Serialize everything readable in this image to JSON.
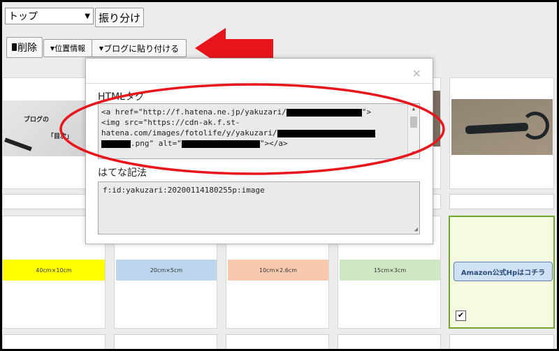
{
  "toolbar": {
    "folder_select": "トップ",
    "distribute_label": "振り分け",
    "delete_label": "削除",
    "location_label": "位置情報",
    "paste_label": "ブログに貼り付ける"
  },
  "dialog": {
    "html_label": "HTMLタグ",
    "html_code": {
      "l1a": "<a href=\"http://f.hatena.ne.jp/yakuzari/",
      "l1b": "\">",
      "l2": "<img src=\"https://cdn-ak.f.st-",
      "l3a": "hatena.com/images/fotolife/y/yakuzari/",
      "l4a": ".png\" alt=\"",
      "l4b": "\"></a>"
    },
    "hatena_label": "はてな記法",
    "hatena_code": "f:id:yakuzari:20200114180255p:image"
  },
  "grid": {
    "thumb1_text1": "ブログの",
    "thumb1_text2": "「目次」",
    "swatch1": "40cm×10cm",
    "swatch2": "20cm×5cm",
    "swatch3": "10cm×2.6cm",
    "swatch4": "15cm×3cm",
    "amazon_label": "Amazon公式Hpはコチラ"
  },
  "colors": {
    "annotation_red": "#e8161c",
    "selected_border": "#72a42e",
    "selected_bg": "#f4fbe0"
  }
}
